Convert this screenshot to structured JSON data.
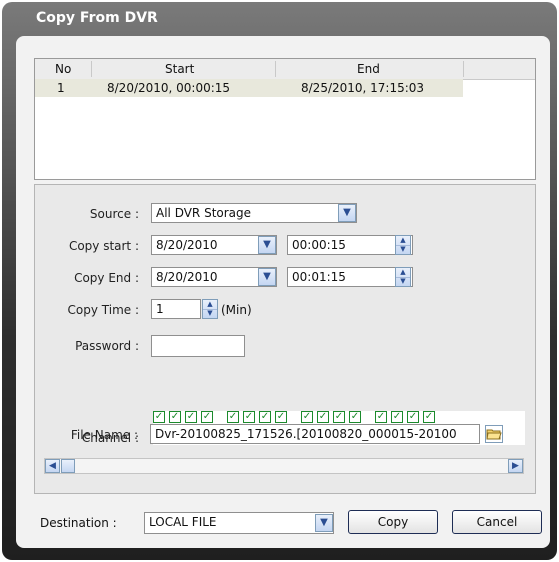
{
  "dialog": {
    "title": "Copy From DVR"
  },
  "list": {
    "headers": [
      "No",
      "Start",
      "End"
    ],
    "rows": [
      {
        "no": "1",
        "start": "8/20/2010, 00:00:15",
        "end": "8/25/2010, 17:15:03"
      }
    ]
  },
  "form": {
    "source_label": "Source :",
    "source_value": "All DVR Storage",
    "copy_start_label": "Copy start :",
    "copy_start_date": "8/20/2010",
    "copy_start_time": "00:00:15",
    "copy_end_label": "Copy End :",
    "copy_end_date": "8/20/2010",
    "copy_end_time": "00:01:15",
    "copy_time_label": "Copy Time :",
    "copy_time_value": "1",
    "copy_time_unit": "(Min)",
    "password_label": "Password :",
    "password_value": "",
    "channel_label": "Channel :",
    "channels": [
      {
        "n": "1",
        "checked": true
      },
      {
        "n": "2",
        "checked": true
      },
      {
        "n": "3",
        "checked": true
      },
      {
        "n": "4",
        "checked": true
      },
      {
        "n": "5",
        "checked": true
      },
      {
        "n": "6",
        "checked": true
      },
      {
        "n": "7",
        "checked": true
      },
      {
        "n": "8",
        "checked": true
      },
      {
        "n": "9",
        "checked": true
      },
      {
        "n": "10",
        "checked": true
      },
      {
        "n": "11",
        "checked": true
      },
      {
        "n": "12",
        "checked": true
      },
      {
        "n": "13",
        "checked": true
      },
      {
        "n": "14",
        "checked": true
      },
      {
        "n": "15",
        "checked": true
      },
      {
        "n": "16",
        "checked": true
      }
    ],
    "file_name_label": "File Name :",
    "file_name_value": "Dvr-20100825_171526.[20100820_000015-20100"
  },
  "footer": {
    "destination_label": "Destination :",
    "destination_value": "LOCAL FILE",
    "copy_button": "Copy",
    "cancel_button": "Cancel"
  }
}
